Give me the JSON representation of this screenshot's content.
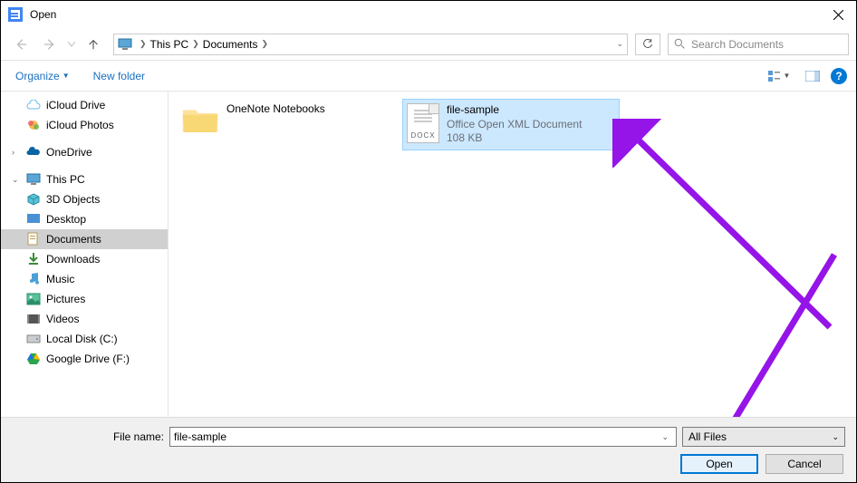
{
  "title": "Open",
  "breadcrumb": {
    "root": "This PC",
    "folder": "Documents"
  },
  "search": {
    "placeholder": "Search Documents"
  },
  "toolbar": {
    "organize": "Organize",
    "newfolder": "New folder"
  },
  "sidebar": {
    "items": [
      {
        "label": "iCloud Drive"
      },
      {
        "label": "iCloud Photos"
      },
      {
        "label": "OneDrive"
      },
      {
        "label": "This PC"
      },
      {
        "label": "3D Objects"
      },
      {
        "label": "Desktop"
      },
      {
        "label": "Documents"
      },
      {
        "label": "Downloads"
      },
      {
        "label": "Music"
      },
      {
        "label": "Pictures"
      },
      {
        "label": "Videos"
      },
      {
        "label": "Local Disk (C:)"
      },
      {
        "label": "Google Drive (F:)"
      }
    ]
  },
  "files": {
    "folder": {
      "name": "OneNote Notebooks"
    },
    "doc": {
      "name": "file-sample",
      "type": "Office Open XML Document",
      "size": "108 KB",
      "ext": "DOCX"
    }
  },
  "footer": {
    "label": "File name:",
    "value": "file-sample",
    "filter": "All Files",
    "open": "Open",
    "cancel": "Cancel"
  }
}
